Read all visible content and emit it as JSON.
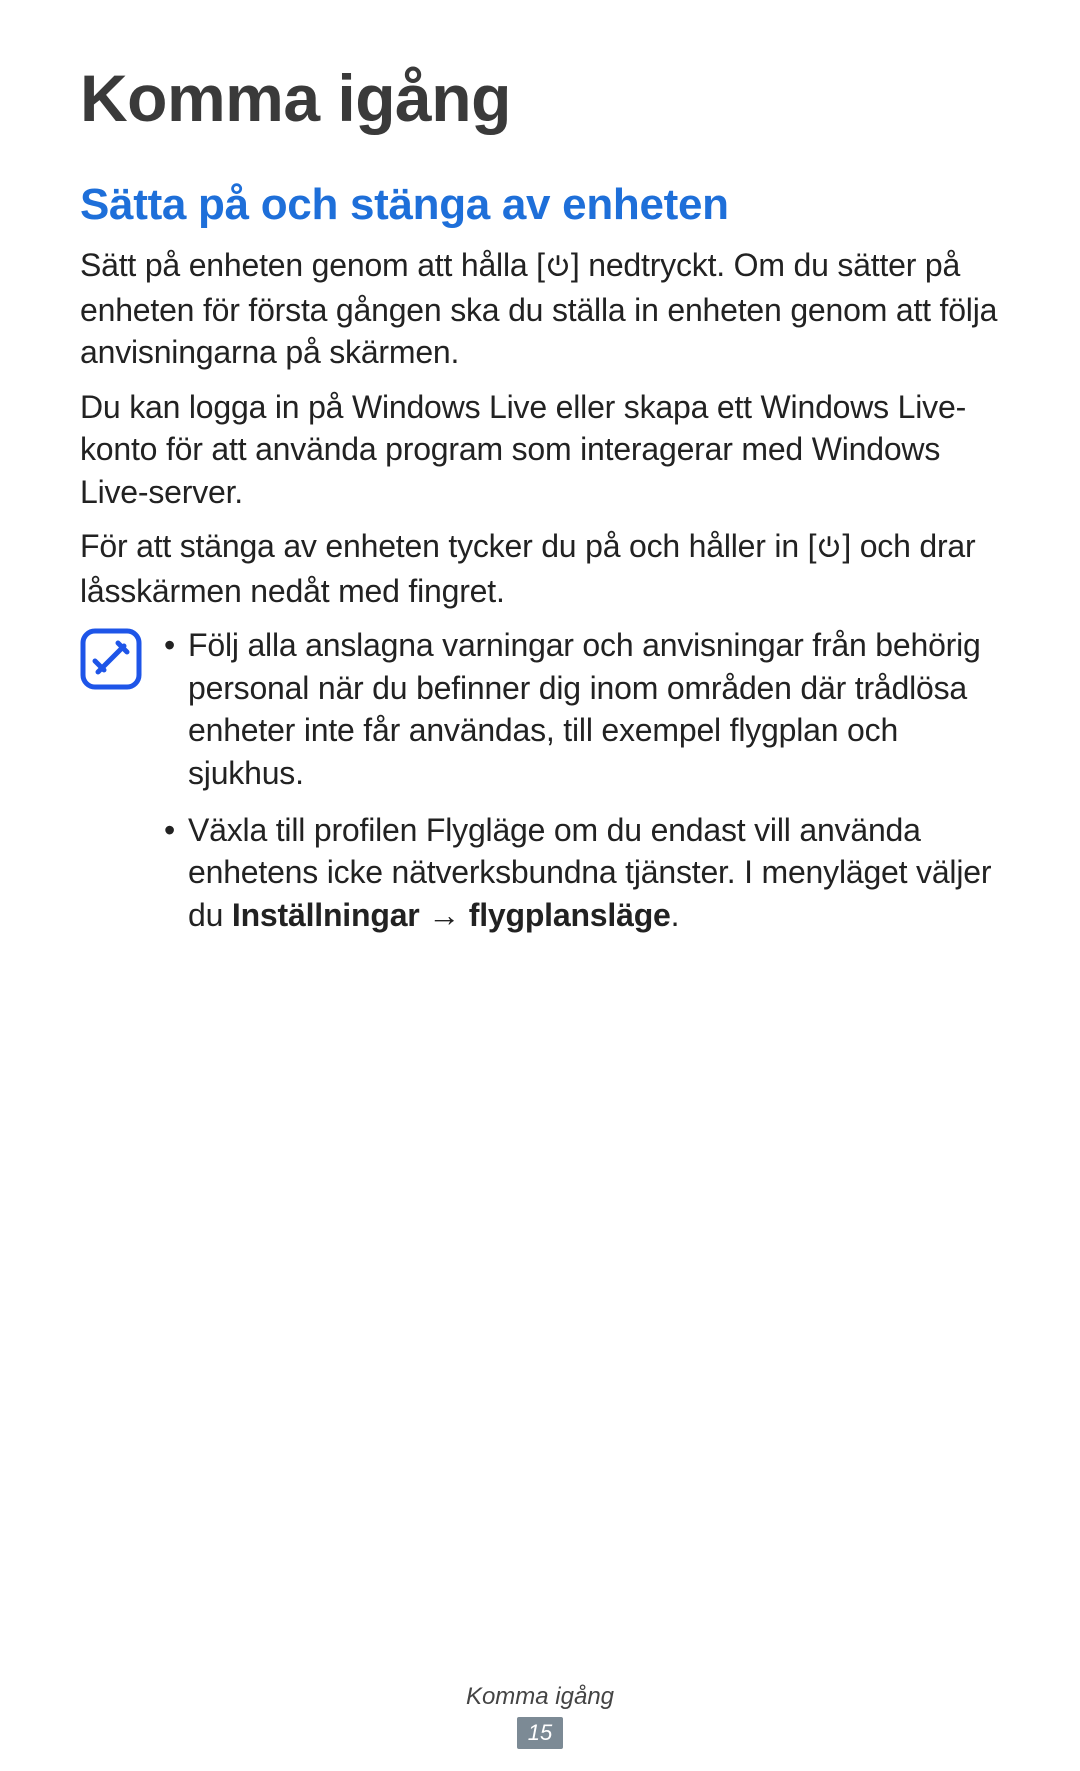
{
  "title": "Komma igång",
  "section_heading": "Sätta på och stänga av enheten",
  "paragraphs": {
    "p1_before": "Sätt på enheten genom att hålla [",
    "p1_after": "] nedtryckt. Om du sätter på enheten för första gången ska du ställa in enheten genom att följa anvisningarna på skärmen.",
    "p2": "Du kan logga in på Windows Live eller skapa ett Windows Live-konto för att använda program som interagerar med Windows Live-server.",
    "p3_before": "För att stänga av enheten tycker du på och håller in [",
    "p3_after": "] och drar låsskärmen nedåt med fingret."
  },
  "note": {
    "bullets": [
      {
        "text": "Följ alla anslagna varningar och anvisningar från behörig personal när du befinner dig inom områden där trådlösa enheter inte får användas, till exempel flygplan och sjukhus."
      },
      {
        "prefix": "Växla till profilen Flygläge om du endast vill använda enhetens icke nätverksbundna tjänster. I menyläget väljer du ",
        "bold1": "Inställningar",
        "arrow": " → ",
        "bold2": "flygplansläge",
        "suffix": "."
      }
    ]
  },
  "footer": {
    "section_label": "Komma igång",
    "page_number": "15"
  }
}
